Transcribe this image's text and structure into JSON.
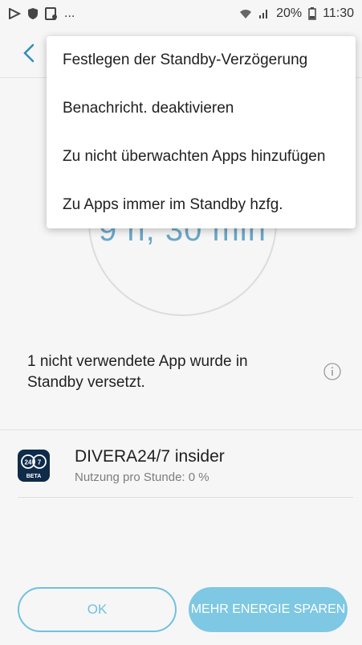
{
  "status_bar": {
    "more": "...",
    "battery": "20%",
    "time": "11:30"
  },
  "icons": {
    "back": "chevron-left-icon",
    "info": "info-icon",
    "app": "divera-app-icon"
  },
  "menu": {
    "items": [
      {
        "label": "Festlegen der Standby-Verzögerung"
      },
      {
        "label": "Benachricht. deaktivieren"
      },
      {
        "label": "Zu nicht überwachten Apps hinzufügen"
      },
      {
        "label": "Zu Apps immer im Standby hzfg."
      }
    ]
  },
  "gauge": {
    "value_text": "9 h, 30 min"
  },
  "info": {
    "text": "1 nicht verwendete App wurde in Standby versetzt."
  },
  "app": {
    "name": "DIVERA24/7 insider",
    "usage": "Nutzung pro Stunde: 0 %",
    "icon_badge_left": "24",
    "icon_badge_right": "7",
    "icon_label": "BETA"
  },
  "buttons": {
    "ok": "OK",
    "save": "MEHR ENERGIE SPAREN"
  },
  "colors": {
    "accent": "#6fc2df",
    "accent_fill": "#7ec8e3",
    "background": "#f6f6f6",
    "app_icon_bg": "#0f2b4a"
  }
}
